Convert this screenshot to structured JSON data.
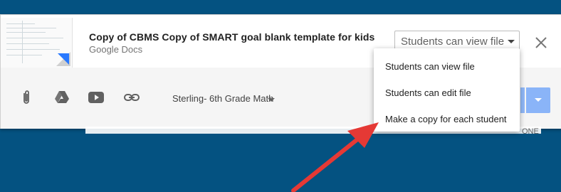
{
  "file": {
    "title": "Copy of CBMS Copy of SMART goal blank template for kids",
    "type": "Google Docs"
  },
  "permission": {
    "selected": "Students can view file",
    "options": [
      "Students can view file",
      "Students can edit file",
      "Make a copy for each student"
    ]
  },
  "toolbar": {
    "class_selected": "Sterling- 6th Grade Math"
  },
  "background": {
    "status_text": "ONE"
  },
  "icons": {
    "attach": "paperclip-icon",
    "drive": "google-drive-icon",
    "youtube": "youtube-icon",
    "link": "link-icon",
    "close": "close-icon"
  },
  "colors": {
    "page_bg": "#045281",
    "assign_button": "#8ab4f8",
    "annotation_arrow": "#e53935"
  }
}
